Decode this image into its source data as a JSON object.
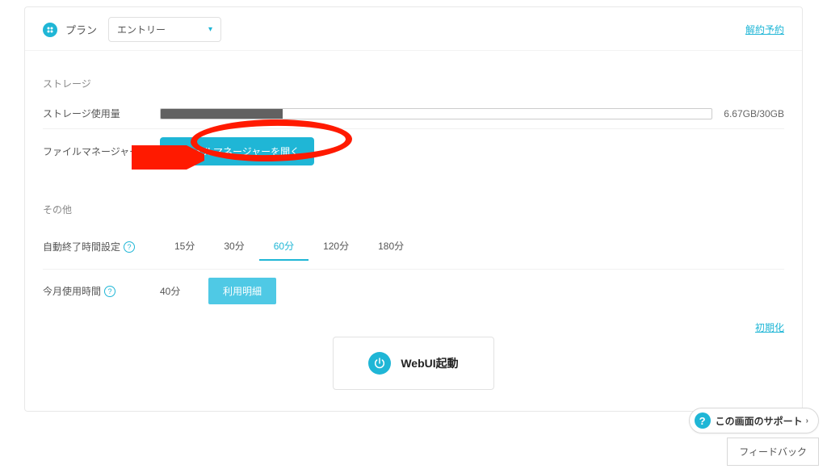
{
  "header": {
    "plan_label": "プラン",
    "plan_value": "エントリー",
    "cancel_link": "解約予約"
  },
  "storage": {
    "section_title": "ストレージ",
    "usage_label": "ストレージ使用量",
    "used_gb": 6.67,
    "total_gb": 30,
    "usage_text": "6.67GB/30GB",
    "fill_percent": 22.2,
    "fm_label": "ファイルマネージャー",
    "fm_button": "ファイルマネージャーを開く"
  },
  "other": {
    "section_title": "その他",
    "autoend_label": "自動終了時間設定",
    "autoend_options": [
      "15分",
      "30分",
      "60分",
      "120分",
      "180分"
    ],
    "autoend_selected_index": 2,
    "usage_label": "今月使用時間",
    "usage_value": "40分",
    "detail_button": "利用明細",
    "reset_link": "初期化"
  },
  "webui": {
    "label": "WebUI起動"
  },
  "support": {
    "label": "この画面のサポート"
  },
  "feedback": {
    "label": "フィードバック"
  }
}
